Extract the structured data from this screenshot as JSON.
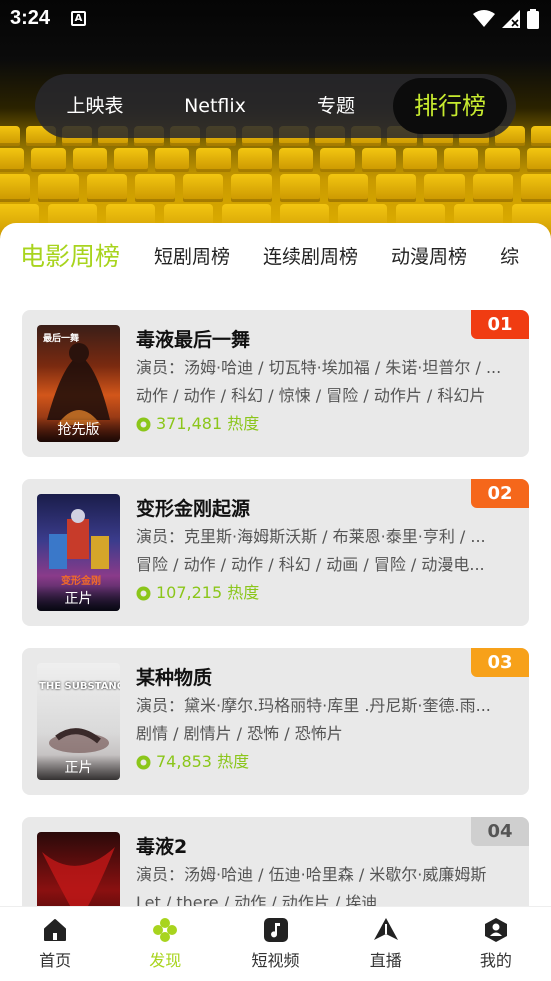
{
  "status_bar": {
    "time": "3:24",
    "a_icon": "A"
  },
  "top_tabs": [
    {
      "label": "上映表"
    },
    {
      "label": "Netflix"
    },
    {
      "label": "专题"
    },
    {
      "label": "排行榜",
      "active": true
    }
  ],
  "category_tabs": [
    {
      "label": "电影周榜",
      "active": true
    },
    {
      "label": "短剧周榜"
    },
    {
      "label": "连续剧周榜"
    },
    {
      "label": "动漫周榜"
    },
    {
      "label": "综"
    }
  ],
  "ranking": [
    {
      "rank": "01",
      "rank_color": "#f03c12",
      "title": "毒液最后一舞",
      "actors": "演员：汤姆·哈迪 / 切瓦特·埃加福 / 朱诺·坦普尔 / ...",
      "genres": "动作 / 动作 / 科幻 / 惊悚 / 冒险 / 动作片 / 科幻片",
      "heat": "371,481 热度",
      "poster_tag": "抢先版",
      "poster_text": "最后一舞"
    },
    {
      "rank": "02",
      "rank_color": "#f5671b",
      "title": "变形金刚起源",
      "actors": "演员：克里斯·海姆斯沃斯 / 布莱恩·泰里·亨利 / ...",
      "genres": "冒险 / 动作 / 动作 / 科幻 / 动画 / 冒险 / 动漫电...",
      "heat": "107,215 热度",
      "poster_tag": "正片",
      "poster_text": "变形金刚"
    },
    {
      "rank": "03",
      "rank_color": "#f7a11a",
      "title": "某种物质",
      "actors": "演员：黛米·摩尔.玛格丽特·库里 .丹尼斯·奎德.雨...",
      "genres": "剧情 / 剧情片 / 恐怖 / 恐怖片",
      "heat": "74,853 热度",
      "poster_tag": "正片",
      "poster_text": "THE SUBSTANCE"
    },
    {
      "rank": "04",
      "rank_color": "#cfcfcf",
      "title": "毒液2",
      "actors": "演员：汤姆·哈迪 / 伍迪·哈里森 / 米歇尔·威廉姆斯",
      "genres": "Let / there / 动作 / 动作片 / 埃迪",
      "heat": "",
      "poster_tag": "",
      "poster_text": ""
    }
  ],
  "bottom_nav": [
    {
      "label": "首页",
      "icon": "home-icon"
    },
    {
      "label": "发现",
      "icon": "discover-icon",
      "active": true
    },
    {
      "label": "短视频",
      "icon": "music-note-icon"
    },
    {
      "label": "直播",
      "icon": "live-icon"
    },
    {
      "label": "我的",
      "icon": "profile-icon"
    }
  ],
  "colors": {
    "accent": "#a8d41e",
    "heat": "#8bc61a"
  }
}
